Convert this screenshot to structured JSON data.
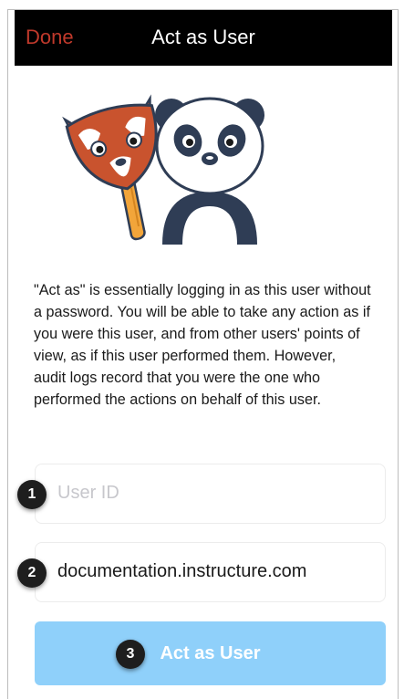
{
  "navbar": {
    "done_label": "Done",
    "title": "Act as User"
  },
  "description": "\"Act as\" is essentially logging in as this user without a password. You will be able to take any action as if you were this user, and from other users' points of view, as if this user performed them. However, audit logs record that you were the one who performed the actions on behalf of this user.",
  "form": {
    "user_id_placeholder": "User ID",
    "domain_value": "documentation.instructure.com",
    "submit_label": "Act as User"
  },
  "steps": [
    "1",
    "2",
    "3"
  ],
  "colors": {
    "navbar_bg": "#000000",
    "done": "#c0392b",
    "button_bg": "#8fd0fa"
  }
}
